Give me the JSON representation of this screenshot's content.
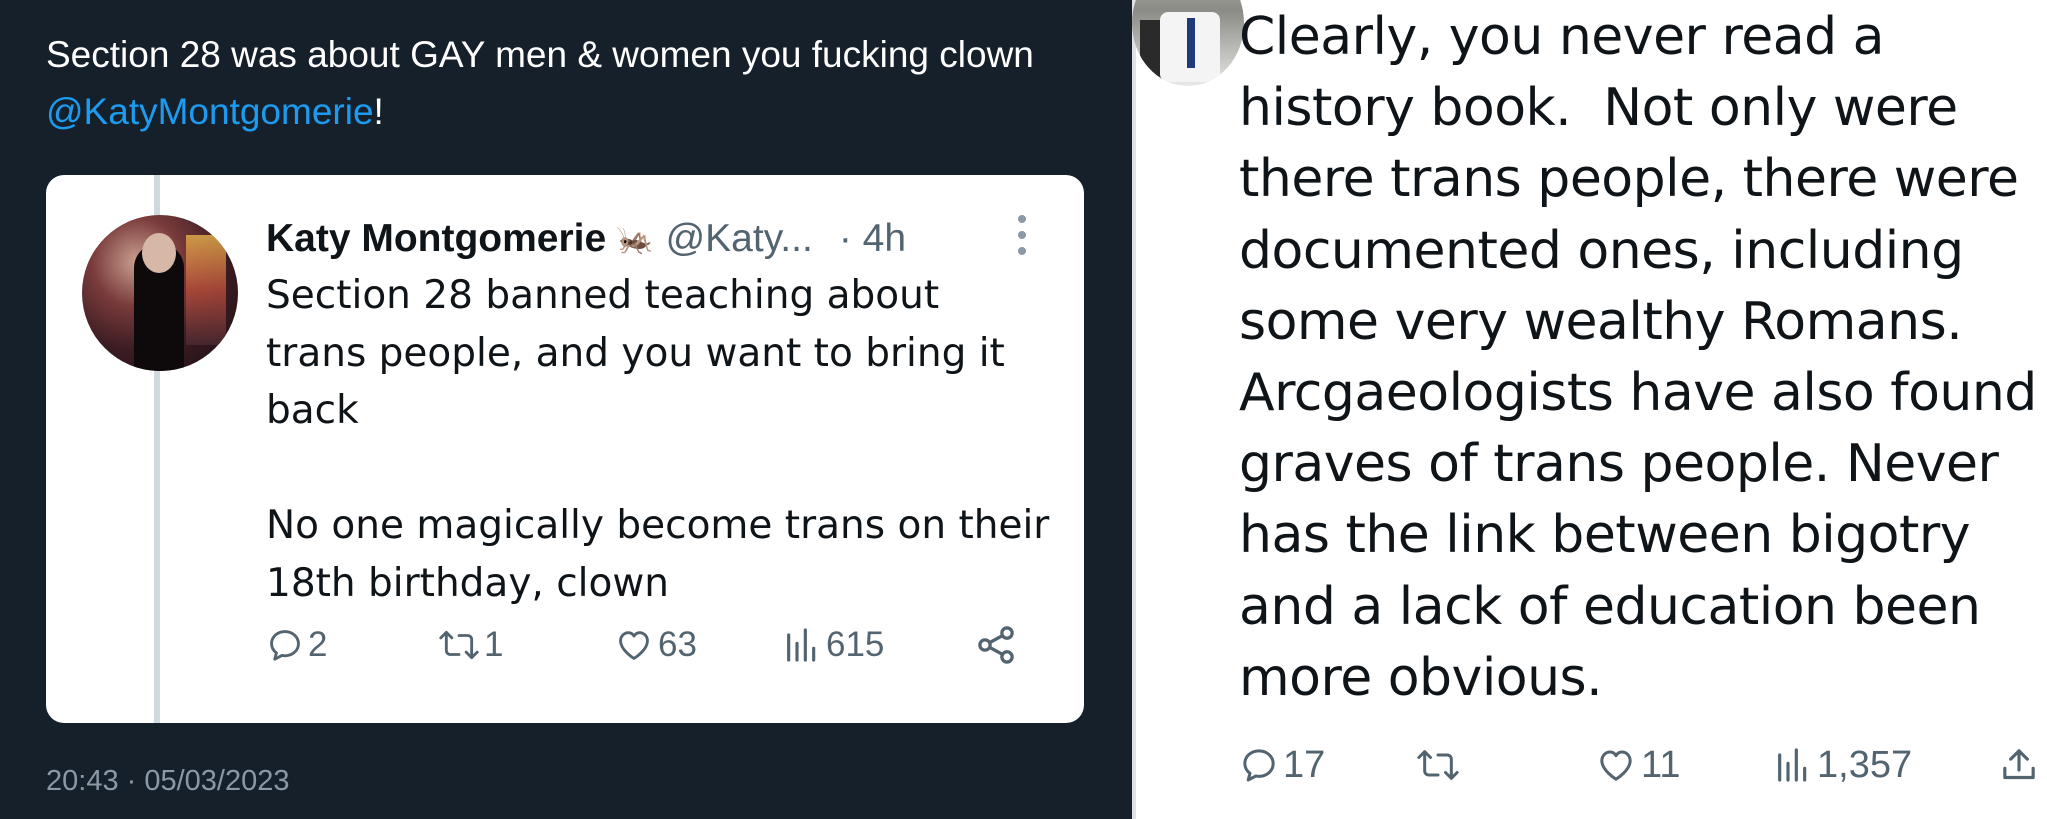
{
  "left_tweet": {
    "text_before": "Section 28 was about GAY men & women you fucking clown ",
    "mention": "@KatyMontgomerie",
    "text_after": "!",
    "timestamp": "20:43 · 05/03/2023"
  },
  "quoted_tweet": {
    "name": "Katy Montgomerie",
    "emoji": "🦗",
    "handle": "@Katy...",
    "time": "· 4h",
    "body": "Section 28 banned teaching about\ntrans people, and you want to bring it\nback\n\nNo one magically become trans on their\n18th birthday, clown",
    "replies": "2",
    "retweets": "1",
    "likes": "63",
    "views": "615"
  },
  "reply_tweet": {
    "text": "Clearly, you never read a\nhistory book.  Not only were\nthere trans people, there were\ndocumented ones, including\nsome very wealthy Romans.\nArcgaeologists have also found\ngraves of trans people. Never\nhas the link between bigotry\nand a lack of education been\nmore obvious.",
    "replies": "17",
    "retweets": "",
    "likes": "11",
    "views": "1,357"
  },
  "colors": {
    "dark_bg": "#15202b",
    "link_blue": "#1d9bf0",
    "muted_gray": "#536471"
  },
  "icons": [
    "reply-icon",
    "retweet-icon",
    "like-icon",
    "views-icon",
    "share-icon",
    "more-icon",
    "upload-icon"
  ]
}
